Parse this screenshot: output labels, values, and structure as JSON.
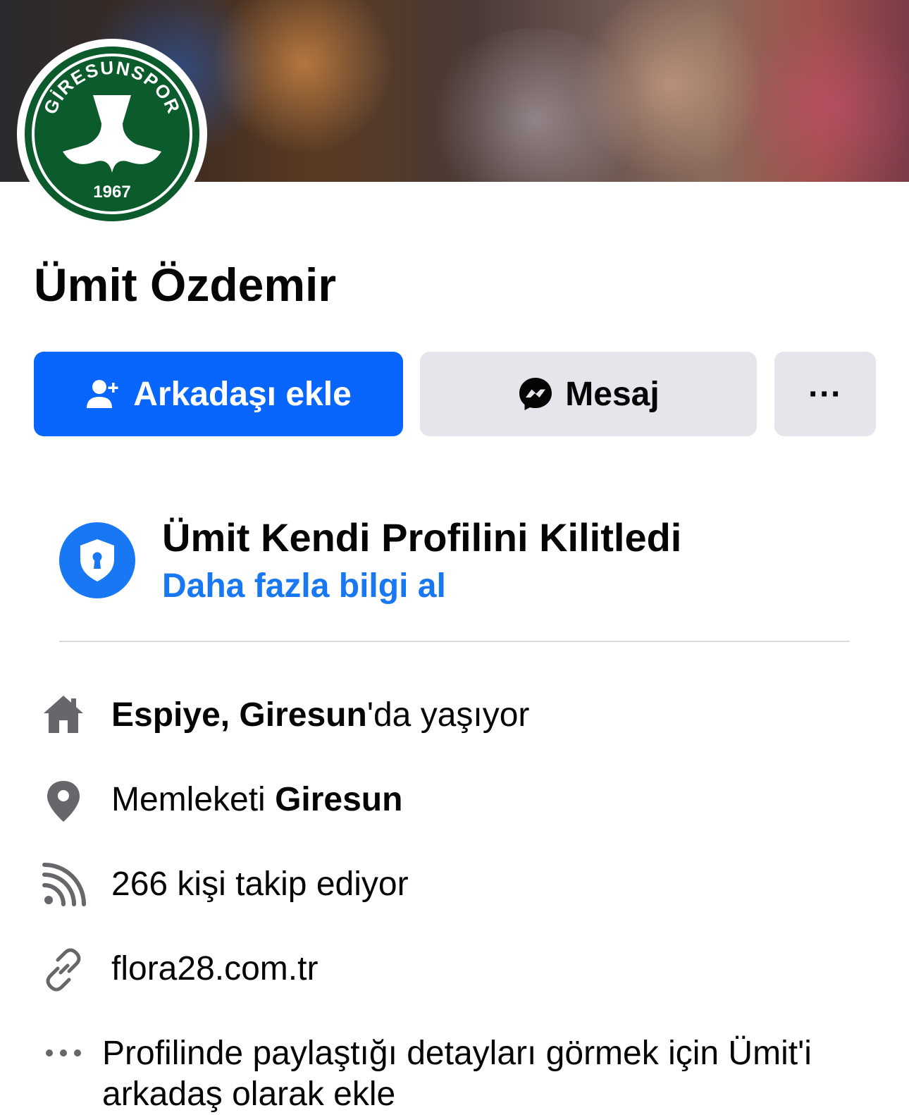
{
  "profile": {
    "name": "Ümit Özdemir",
    "avatar_badge_text": "GİRESUNSPOR",
    "avatar_year": "1967"
  },
  "actions": {
    "add_friend_label": "Arkadaşı ekle",
    "message_label": "Mesaj",
    "more_label": "···"
  },
  "locked_notice": {
    "title": "Ümit Kendi Profilini Kilitledi",
    "link": "Daha fazla bilgi al"
  },
  "details": {
    "lives_place": "Espiye, Giresun",
    "lives_suffix": "'da yaşıyor",
    "hometown_prefix": "Memleketi ",
    "hometown_place": "Giresun",
    "followers": "266 kişi takip ediyor",
    "website": "flora28.com.tr",
    "more_info": "Profilinde paylaştığı detayları görmek için Ümit'i arkadaş olarak ekle"
  },
  "colors": {
    "primary_blue": "#0866ff",
    "link_blue": "#1877f2",
    "button_gray": "#e4e6eb",
    "icon_gray": "#65676b",
    "badge_green": "#0c5b2c"
  }
}
